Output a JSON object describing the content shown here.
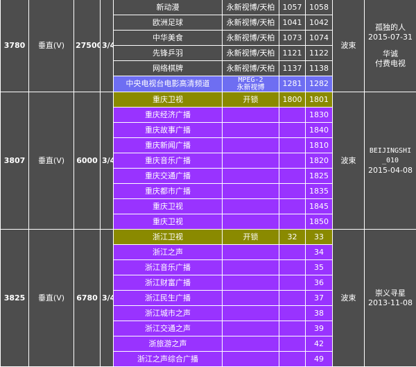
{
  "groups": [
    {
      "tp": "3780",
      "polarity": "垂直(V)",
      "symbol_rate": "27500",
      "fec": "3/4",
      "beam": "波束",
      "note": {
        "user": "孤独的人",
        "date": "2015-07-31",
        "extra": "华诚",
        "extra2": "付费电视"
      },
      "rows": [
        {
          "type": "gray",
          "name": "新动漫",
          "system": "永新视博/天柏",
          "vpid": "1057",
          "apid": "1058"
        },
        {
          "type": "gray",
          "name": "欧洲足球",
          "system": "永新视博/天柏",
          "vpid": "1041",
          "apid": "1042"
        },
        {
          "type": "gray",
          "name": "中华美食",
          "system": "永新视博/天柏",
          "vpid": "1073",
          "apid": "1074"
        },
        {
          "type": "gray",
          "name": "先锋乒羽",
          "system": "永新视博/天柏",
          "vpid": "1121",
          "apid": "1122"
        },
        {
          "type": "gray",
          "name": "网络棋牌",
          "system": "永新视博/天柏",
          "vpid": "1137",
          "apid": "1138"
        },
        {
          "type": "blue",
          "name": "中央电视台电影高清频道",
          "system_line1": "MPEG-2",
          "system_line2": "永新视博",
          "vpid": "1281",
          "apid": "1282"
        }
      ]
    },
    {
      "tp": "3807",
      "polarity": "垂直(V)",
      "symbol_rate": "6000",
      "fec": "3/4",
      "beam": "波束",
      "note": {
        "user_line1": "BEIJINGSHI",
        "user_line2": "_010",
        "date": "2015-04-08"
      },
      "rows": [
        {
          "type": "olive",
          "name": "重庆卫视",
          "system": "开锁",
          "vpid": "1800",
          "apid": "1801"
        },
        {
          "type": "purple",
          "name": "重庆经济广播",
          "system": "",
          "vpid": "",
          "apid": "1830"
        },
        {
          "type": "purple",
          "name": "重庆故事广播",
          "system": "",
          "vpid": "",
          "apid": "1840"
        },
        {
          "type": "purple",
          "name": "重庆新闻广播",
          "system": "",
          "vpid": "",
          "apid": "1810"
        },
        {
          "type": "purple",
          "name": "重庆音乐广播",
          "system": "",
          "vpid": "",
          "apid": "1820"
        },
        {
          "type": "purple",
          "name": "重庆交通广播",
          "system": "",
          "vpid": "",
          "apid": "1825"
        },
        {
          "type": "purple",
          "name": "重庆都市广播",
          "system": "",
          "vpid": "",
          "apid": "1835"
        },
        {
          "type": "purple",
          "name": "重庆卫视",
          "system": "",
          "vpid": "",
          "apid": "1845"
        },
        {
          "type": "purple",
          "name": "重庆卫视",
          "system": "",
          "vpid": "",
          "apid": "1850"
        }
      ]
    },
    {
      "tp": "3825",
      "polarity": "垂直(V)",
      "symbol_rate": "6780",
      "fec": "3/4",
      "beam": "波束",
      "note": {
        "user": "崇义寻星",
        "date": "2013-11-08"
      },
      "rows": [
        {
          "type": "olive",
          "name": "浙江卫视",
          "system": "开锁",
          "vpid": "32",
          "apid": "33"
        },
        {
          "type": "purple",
          "name": "浙江之声",
          "system": "",
          "vpid": "",
          "apid": "34"
        },
        {
          "type": "purple",
          "name": "浙江音乐广播",
          "system": "",
          "vpid": "",
          "apid": "35"
        },
        {
          "type": "purple",
          "name": "浙江财富广播",
          "system": "",
          "vpid": "",
          "apid": "36"
        },
        {
          "type": "purple",
          "name": "浙江民生广播",
          "system": "",
          "vpid": "",
          "apid": "37"
        },
        {
          "type": "purple",
          "name": "浙江城市之声",
          "system": "",
          "vpid": "",
          "apid": "38"
        },
        {
          "type": "purple",
          "name": "浙江交通之声",
          "system": "",
          "vpid": "",
          "apid": "39"
        },
        {
          "type": "purple",
          "name": "浙旅游之声",
          "system": "",
          "vpid": "",
          "apid": "42"
        },
        {
          "type": "purple",
          "name": "浙江之声综合广播",
          "system": "",
          "vpid": "",
          "apid": "49"
        }
      ]
    }
  ]
}
